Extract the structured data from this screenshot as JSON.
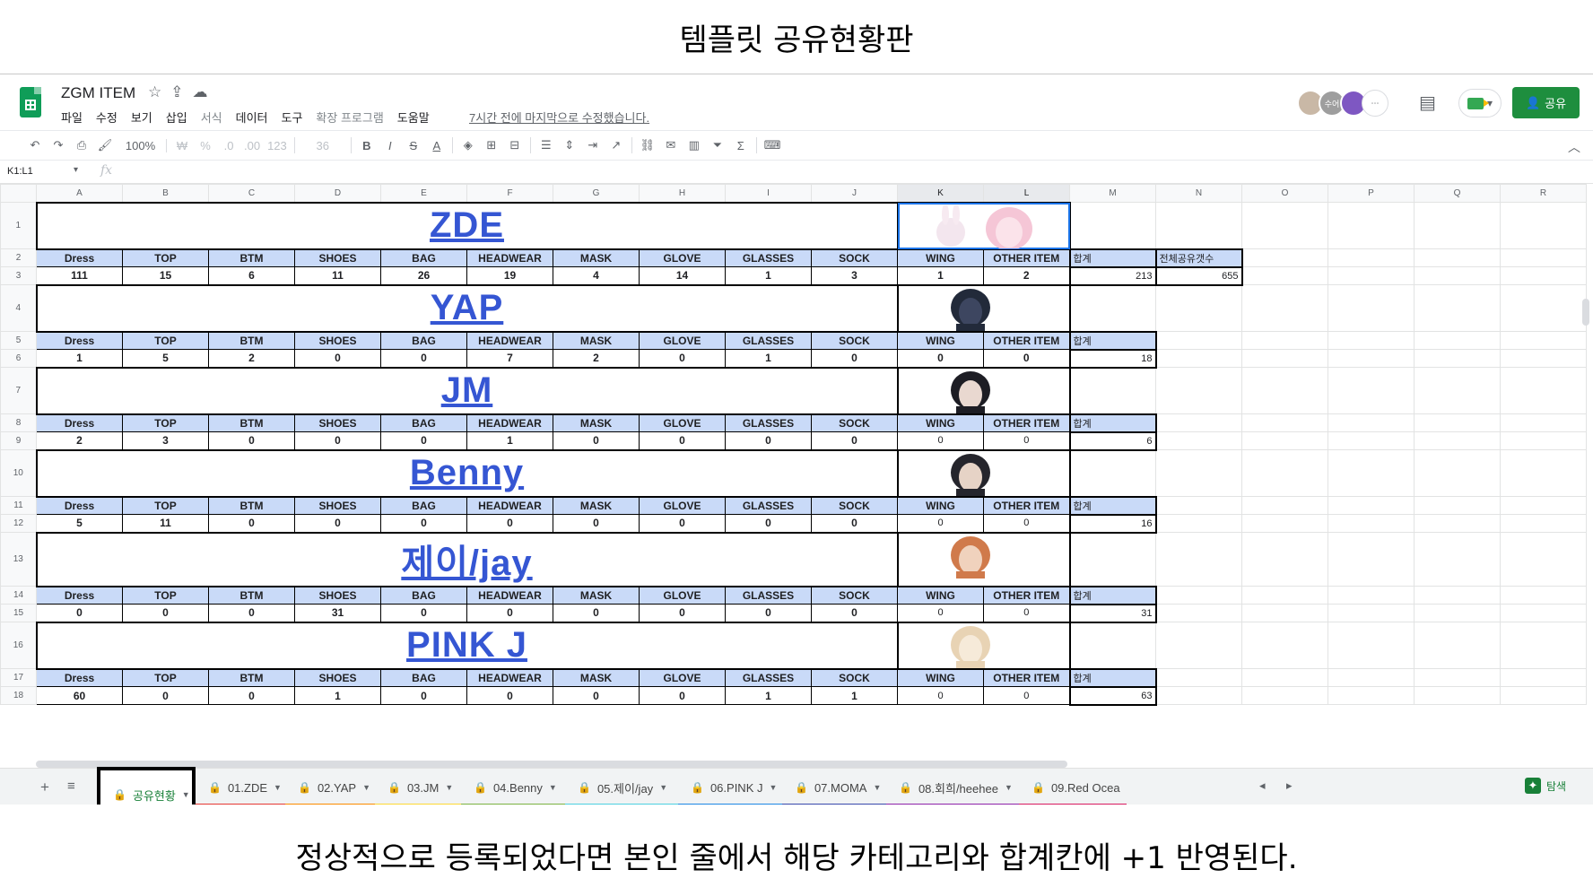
{
  "captions": {
    "top": "템플릿 공유현황판",
    "bottom": "정상적으로 등록되었다면 본인 줄에서 해당 카테고리와 합계칸에 +1 반영된다."
  },
  "app": {
    "doc_title": "ZGM ITEM",
    "menu": [
      "파일",
      "수정",
      "보기",
      "삽입",
      "서식",
      "데이터",
      "도구",
      "확장 프로그램",
      "도움말"
    ],
    "last_edit": "7시간 전에 마지막으로 수정했습니다.",
    "share_label": "공유",
    "avatar_label": "수어",
    "toolbar": {
      "zoom": "100%",
      "currency": "₩",
      "percent": "%",
      "dec_down": ".0",
      "dec_up": ".00",
      "format_more": "123",
      "font_size": "36"
    },
    "name_box": "K1:L1",
    "fx": "fx",
    "columns": [
      "A",
      "B",
      "C",
      "D",
      "E",
      "F",
      "G",
      "H",
      "I",
      "J",
      "K",
      "L",
      "M",
      "N",
      "O",
      "P",
      "Q",
      "R"
    ],
    "category_labels": [
      "Dress",
      "TOP",
      "BTM",
      "SHOES",
      "BAG",
      "HEADWEAR",
      "MASK",
      "GLOVE",
      "GLASSES",
      "SOCK",
      "WING",
      "OTHER ITEM"
    ],
    "sum_label": "합계",
    "total_label": "전체공유갯수",
    "total_value": "655",
    "members": [
      {
        "name": "ZDE",
        "values": [
          "111",
          "15",
          "6",
          "11",
          "26",
          "19",
          "4",
          "14",
          "1",
          "3",
          "1",
          "2"
        ],
        "sum": "213",
        "rows": [
          "1",
          "2",
          "3"
        ]
      },
      {
        "name": "YAP",
        "values": [
          "1",
          "5",
          "2",
          "0",
          "0",
          "7",
          "2",
          "0",
          "1",
          "0",
          "0",
          "0"
        ],
        "sum": "18",
        "rows": [
          "4",
          "5",
          "6"
        ]
      },
      {
        "name": "JM",
        "values": [
          "2",
          "3",
          "0",
          "0",
          "0",
          "1",
          "0",
          "0",
          "0",
          "0",
          "0",
          "0"
        ],
        "sum": "6",
        "rows": [
          "7",
          "8",
          "9"
        ]
      },
      {
        "name": "Benny",
        "values": [
          "5",
          "11",
          "0",
          "0",
          "0",
          "0",
          "0",
          "0",
          "0",
          "0",
          "0",
          "0"
        ],
        "sum": "16",
        "rows": [
          "10",
          "11",
          "12"
        ]
      },
      {
        "name": "제이/jay",
        "values": [
          "0",
          "0",
          "0",
          "31",
          "0",
          "0",
          "0",
          "0",
          "0",
          "0",
          "0",
          "0"
        ],
        "sum": "31",
        "rows": [
          "13",
          "14",
          "15"
        ]
      },
      {
        "name": "PINK J",
        "values": [
          "60",
          "0",
          "0",
          "1",
          "0",
          "0",
          "0",
          "0",
          "1",
          "1",
          "0",
          "0"
        ],
        "sum": "63",
        "rows": [
          "16",
          "17",
          "18"
        ]
      }
    ],
    "tabs": [
      {
        "label": "공유현황",
        "stripe": "#ffffff"
      },
      {
        "label": "01.ZDE",
        "stripe": "#e53935"
      },
      {
        "label": "02.YAP",
        "stripe": "#fb8c00"
      },
      {
        "label": "03.JM",
        "stripe": "#fdd835"
      },
      {
        "label": "04.Benny",
        "stripe": "#7cb342"
      },
      {
        "label": "05.제이/jay",
        "stripe": "#4dd0e1"
      },
      {
        "label": "06.PINK J",
        "stripe": "#1e88e5"
      },
      {
        "label": "07.MOMA",
        "stripe": "#3949ab"
      },
      {
        "label": "08.회희/heehee",
        "stripe": "#8e24aa"
      },
      {
        "label": "09.Red Ocea",
        "stripe": "#d81b60"
      }
    ],
    "explore_label": "탐색",
    "colors": {
      "header_fill": "#c9daf8",
      "banner_text": "#3556d3",
      "share_button": "#1e8e3e",
      "active_tab_text": "#188038"
    }
  }
}
